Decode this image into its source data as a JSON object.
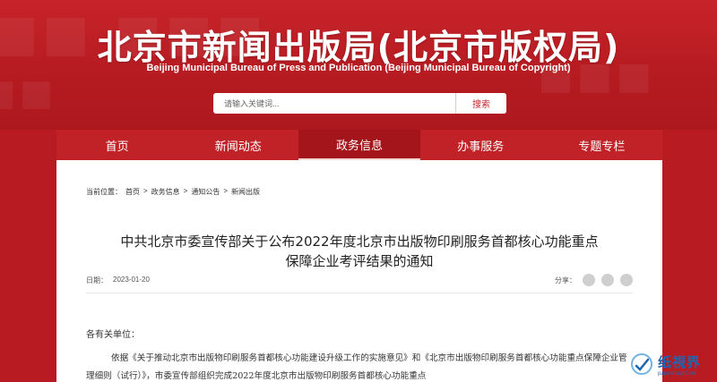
{
  "header": {
    "title": "北京市新闻出版局(北京市版权局)",
    "subtitle": "Beijing Municipal Bureau of Press and Publication (Beijing Municipal Bureau of Copyright)"
  },
  "search": {
    "placeholder": "请输入关键词...",
    "button_label": "搜索"
  },
  "nav": {
    "items": [
      {
        "label": "首页"
      },
      {
        "label": "新闻动态"
      },
      {
        "label": "政务信息",
        "active": true
      },
      {
        "label": "办事服务"
      },
      {
        "label": "专题专栏"
      }
    ]
  },
  "breadcrumb": {
    "prefix": "当前位置：",
    "items": [
      "首页",
      "政务信息",
      "通知公告",
      "新闻出版"
    ],
    "separator": ">"
  },
  "article": {
    "title_line1": "中共北京市委宣传部关于公布2022年度北京市出版物印刷服务首都核心功能重点",
    "title_line2": "保障企业考评结果的通知",
    "date_label": "日期：",
    "date": "2023-01-20",
    "share_label": "分享：",
    "salutation": "各有关单位：",
    "paragraph": "依据《关于推动北京市出版物印刷服务首都核心功能建设升级工作的实施意见》和《北京市出版物印刷服务首都核心功能重点保障企业管理细则（试行）》，市委宣传部组织完成2022年度北京市出版物印刷服务首都核心功能重点"
  },
  "watermark": {
    "name": "纸視界",
    "url": "paperinsight.net"
  },
  "colors": {
    "brand_red": "#c02228",
    "nav_active": "#a3151b",
    "watermark_blue": "#1c66b3"
  }
}
